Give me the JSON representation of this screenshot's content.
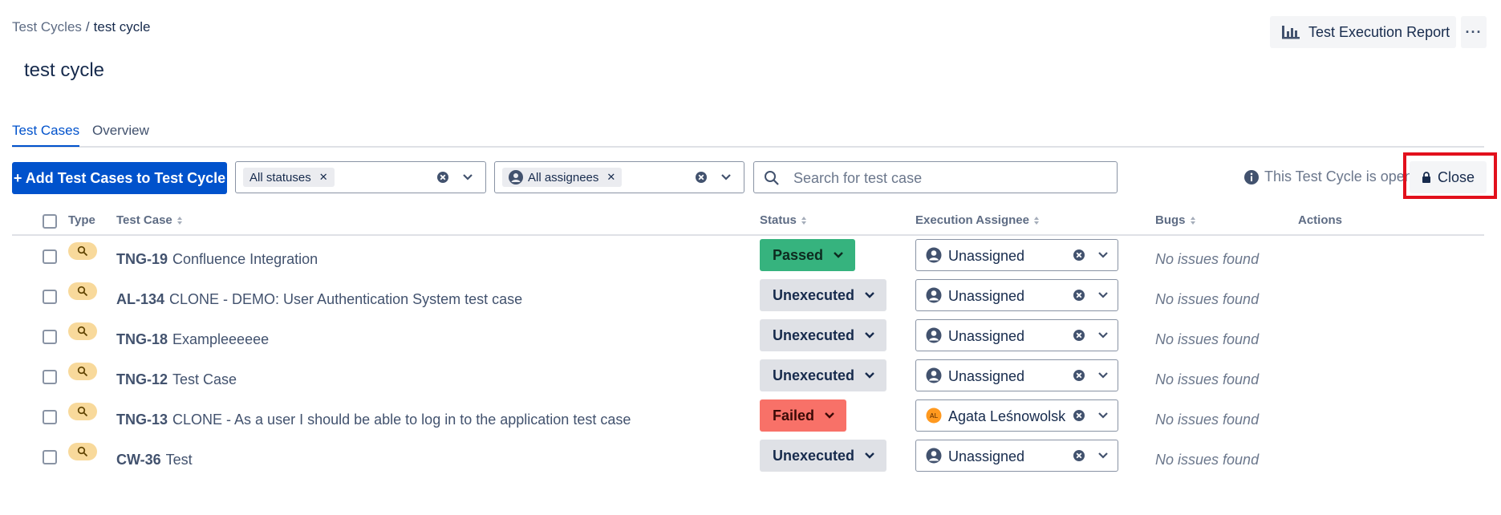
{
  "breadcrumb": {
    "parent": "Test Cycles",
    "separator": "/",
    "current": "test cycle"
  },
  "page_title": "test cycle",
  "header_actions": {
    "report_label": "Test Execution Report",
    "more_label": "···"
  },
  "tabs": [
    {
      "label": "Test Cases",
      "active": true
    },
    {
      "label": "Overview",
      "active": false
    }
  ],
  "toolbar": {
    "add_label": "+ Add Test Cases to Test Cycle",
    "status_filter_chip": "All statuses",
    "assignee_filter_chip": "All assignees",
    "search_placeholder": "Search for test case",
    "open_info": "This Test Cycle is open",
    "close_label": "Close"
  },
  "columns": {
    "type": "Type",
    "test_case": "Test Case",
    "status": "Status",
    "assignee": "Execution Assignee",
    "bugs": "Bugs",
    "actions": "Actions"
  },
  "colors": {
    "primary": "#0052cc",
    "passed": "#36b37e",
    "failed": "#f87168",
    "unexecuted": "#dfe1e6",
    "highlight": "#e2101c",
    "type_badge": "#f8d99b"
  },
  "rows": [
    {
      "key": "TNG-19",
      "title": "Confluence Integration",
      "status": "Passed",
      "assignee": "Unassigned",
      "bugs": "No issues found"
    },
    {
      "key": "AL-134",
      "title": "CLONE - DEMO: User Authentication System test case",
      "status": "Unexecuted",
      "assignee": "Unassigned",
      "bugs": "No issues found"
    },
    {
      "key": "TNG-18",
      "title": "Exampleeeeee",
      "status": "Unexecuted",
      "assignee": "Unassigned",
      "bugs": "No issues found"
    },
    {
      "key": "TNG-12",
      "title": "Test Case",
      "status": "Unexecuted",
      "assignee": "Unassigned",
      "bugs": "No issues found"
    },
    {
      "key": "TNG-13",
      "title": "CLONE - As a user I should be able to log in to the application test case",
      "status": "Failed",
      "assignee": "Agata Leśnowolska",
      "assignee_initials": "AL",
      "bugs": "No issues found"
    },
    {
      "key": "CW-36",
      "title": "Test",
      "status": "Unexecuted",
      "assignee": "Unassigned",
      "bugs": "No issues found"
    }
  ]
}
